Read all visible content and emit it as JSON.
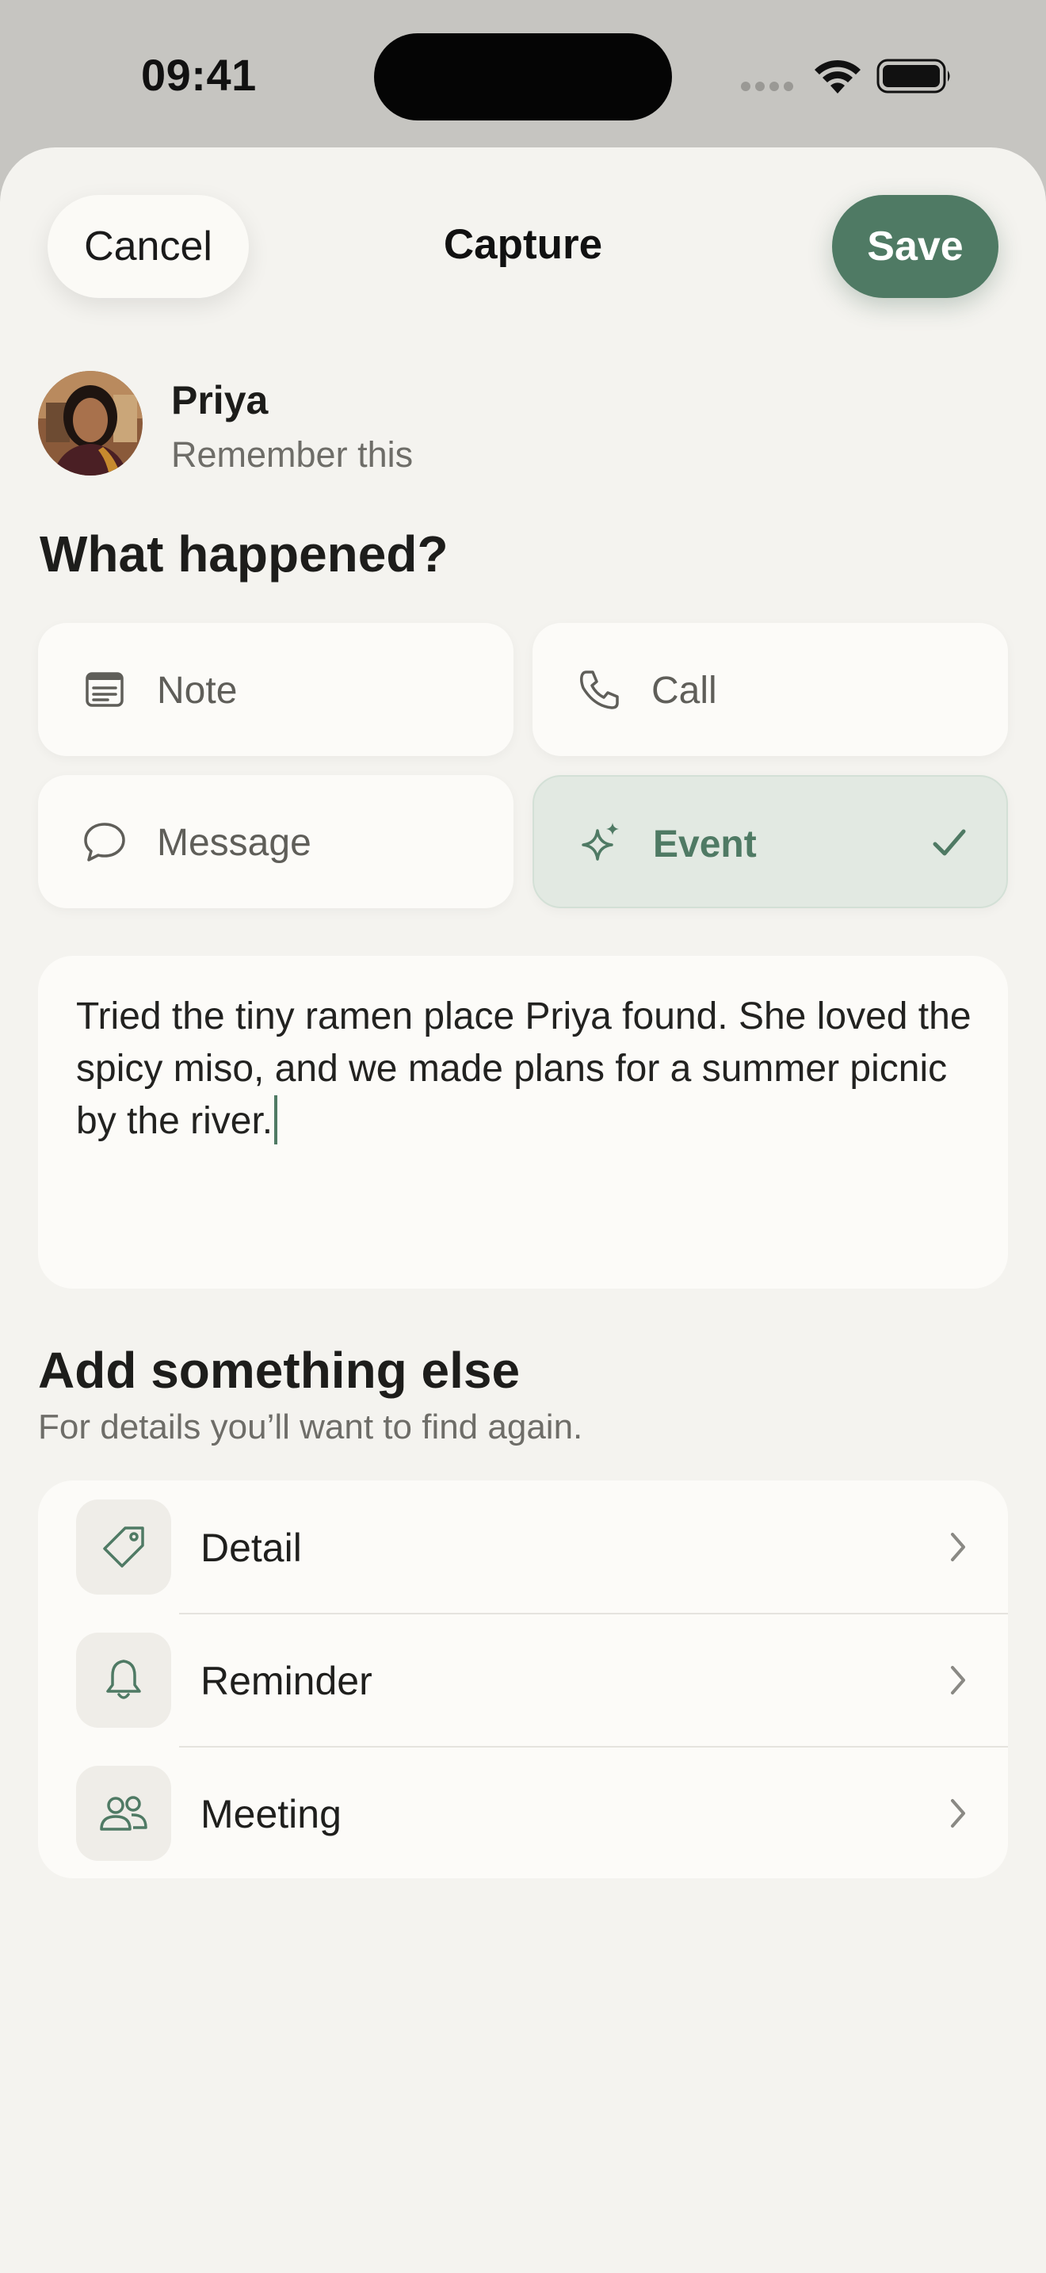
{
  "status_bar": {
    "time": "09:41",
    "icons": [
      "cellular-icon",
      "wifi-icon",
      "battery-icon"
    ]
  },
  "nav": {
    "cancel_label": "Cancel",
    "title": "Capture",
    "save_label": "Save"
  },
  "contact": {
    "name": "Priya",
    "subtitle": "Remember this"
  },
  "what_happened": {
    "heading": "What happened?",
    "types": [
      {
        "label": "Note",
        "icon": "note-icon",
        "selected": false
      },
      {
        "label": "Call",
        "icon": "phone-icon",
        "selected": false
      },
      {
        "label": "Message",
        "icon": "message-icon",
        "selected": false
      },
      {
        "label": "Event",
        "icon": "sparkle-icon",
        "selected": true
      }
    ]
  },
  "note": {
    "text": "Tried the tiny ramen place Priya found. She loved the spicy miso, and we made plans for a summer picnic by the river."
  },
  "add_more": {
    "heading": "Add something else",
    "subheading": "For details you’ll want to find again.",
    "items": [
      {
        "label": "Detail",
        "icon": "tag-icon"
      },
      {
        "label": "Reminder",
        "icon": "bell-icon"
      },
      {
        "label": "Meeting",
        "icon": "people-icon"
      }
    ]
  },
  "colors": {
    "accent": "#4f7a64",
    "selected_bg": "#e2e9e2",
    "card_bg": "#fcfbf8",
    "sheet_bg": "#f4f3ef"
  }
}
